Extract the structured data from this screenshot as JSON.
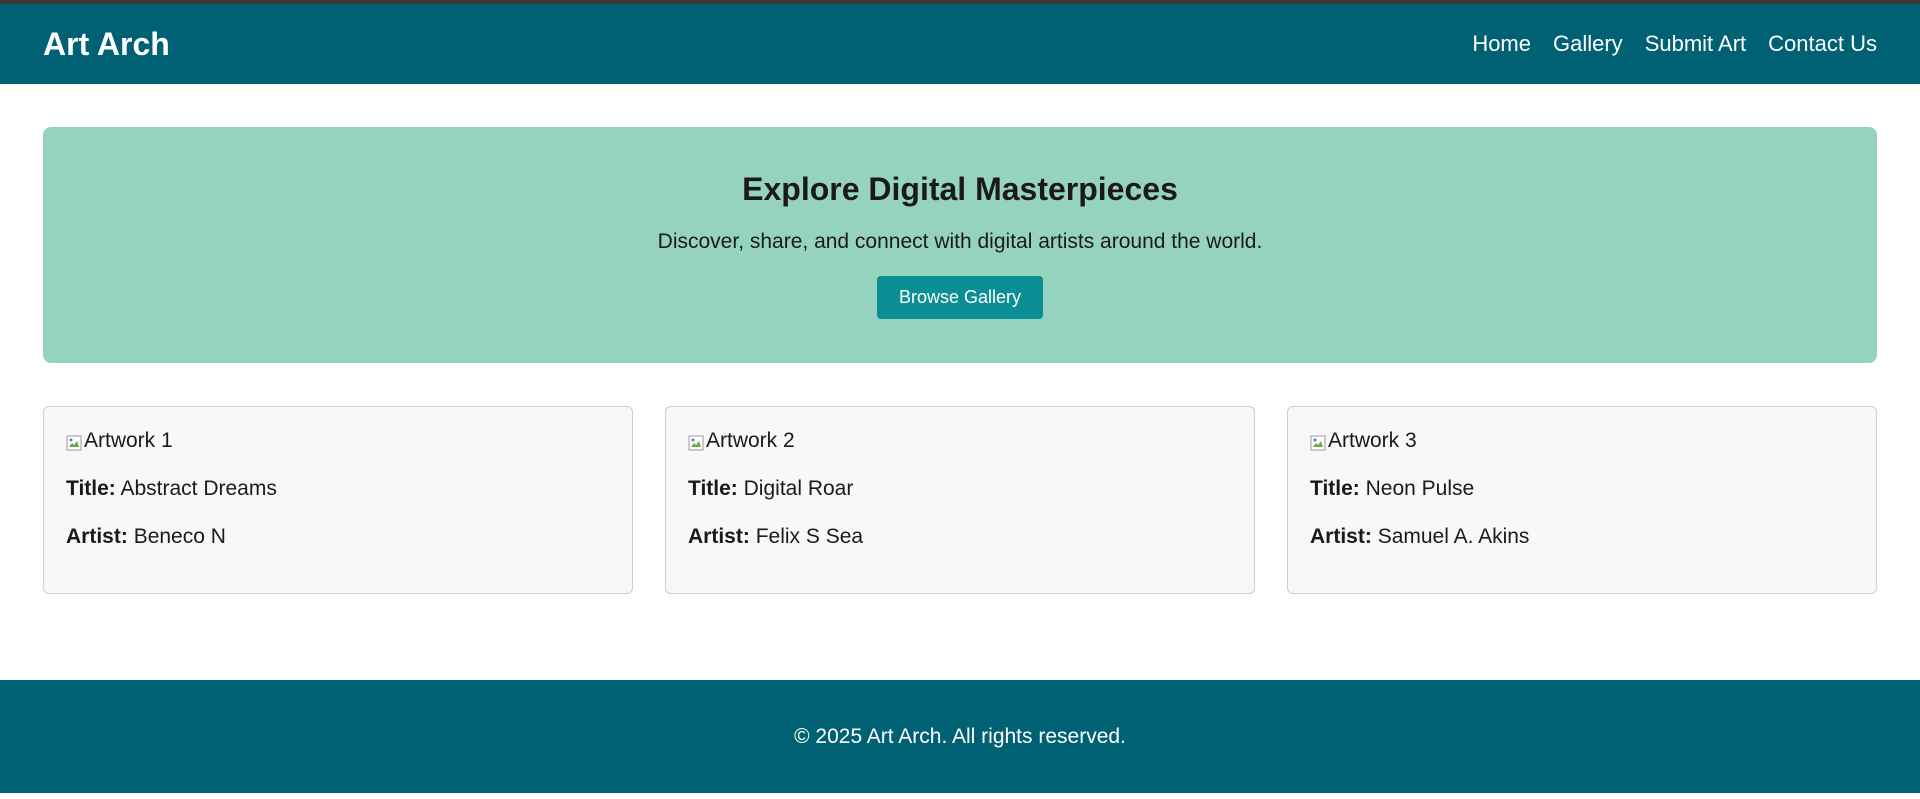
{
  "header": {
    "brand": "Art Arch",
    "nav": [
      "Home",
      "Gallery",
      "Submit Art",
      "Contact Us"
    ]
  },
  "hero": {
    "title": "Explore Digital Masterpieces",
    "subtitle": "Discover, share, and connect with digital artists around the world.",
    "button_label": "Browse Gallery"
  },
  "cards": [
    {
      "image_alt": "Artwork 1",
      "title_label": "Title:",
      "title": "Abstract Dreams",
      "artist_label": "Artist:",
      "artist": "Beneco N"
    },
    {
      "image_alt": "Artwork 2",
      "title_label": "Title:",
      "title": "Digital Roar",
      "artist_label": "Artist:",
      "artist": "Felix S Sea"
    },
    {
      "image_alt": "Artwork 3",
      "title_label": "Title:",
      "title": "Neon Pulse",
      "artist_label": "Artist:",
      "artist": "Samuel A. Akins"
    }
  ],
  "footer": {
    "text": "© 2025 Art Arch. All rights reserved."
  },
  "colors": {
    "header_bg": "#006175",
    "hero_bg": "#96d3be",
    "button_bg": "#0b8e94",
    "card_bg": "#f8f8f8"
  }
}
